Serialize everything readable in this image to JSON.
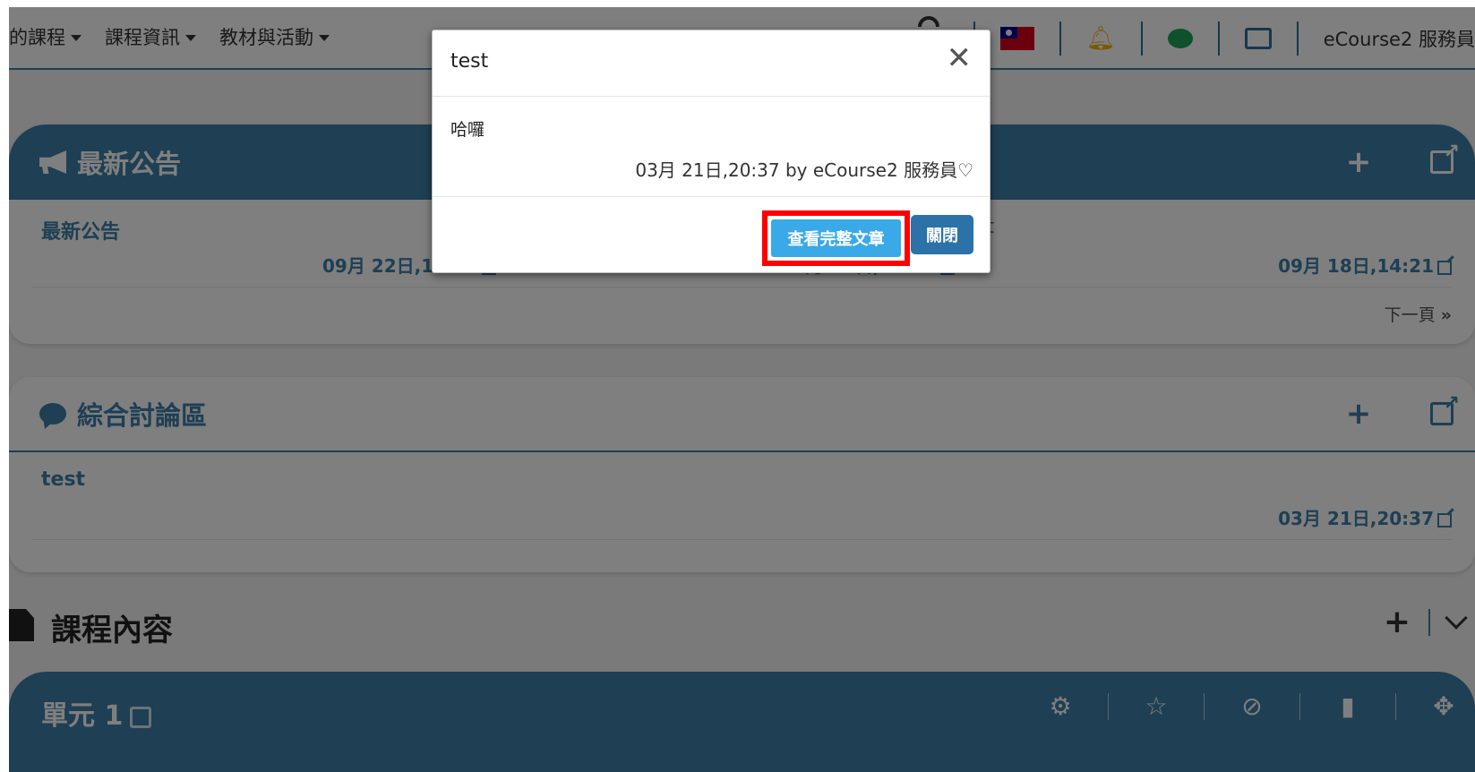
{
  "nav": {
    "items": [
      {
        "label": "的課程"
      },
      {
        "label": "課程資訊"
      },
      {
        "label": "教材與活動"
      }
    ],
    "user": "eCourse2 服務員"
  },
  "announcements": {
    "title": "最新公告",
    "items": [
      {
        "title": "最新公告",
        "date": "09月 22日,15:25"
      },
      {
        "title": "",
        "date": "09月 18日,14:56"
      },
      {
        "title": "test",
        "date": "09月 18日,14:21"
      }
    ],
    "next_page": "下一頁"
  },
  "discussion": {
    "title": "綜合討論區",
    "items": [
      {
        "title": "test",
        "date": "03月 21日,20:37"
      }
    ]
  },
  "course_content": {
    "title": "課程內容"
  },
  "unit": {
    "title": "單元 1"
  },
  "modal": {
    "title": "test",
    "body": "哈囉",
    "meta": "03月 21日,20:37 by eCourse2 服務員♡",
    "view_full_label": "查看完整文章",
    "close_label": "關閉"
  },
  "colors": {
    "primary": "#3d7fa8",
    "button_light": "#3aa9e8",
    "button_dark": "#2a72a8",
    "highlight": "#ff0000"
  },
  "icons": [
    "megaphone-icon",
    "plus-icon",
    "external-link-icon",
    "comment-icon",
    "document-icon",
    "gear-icon",
    "star-icon",
    "eye-slash-icon",
    "trash-icon",
    "move-icon",
    "bell-icon",
    "flag-icon",
    "close-icon"
  ]
}
